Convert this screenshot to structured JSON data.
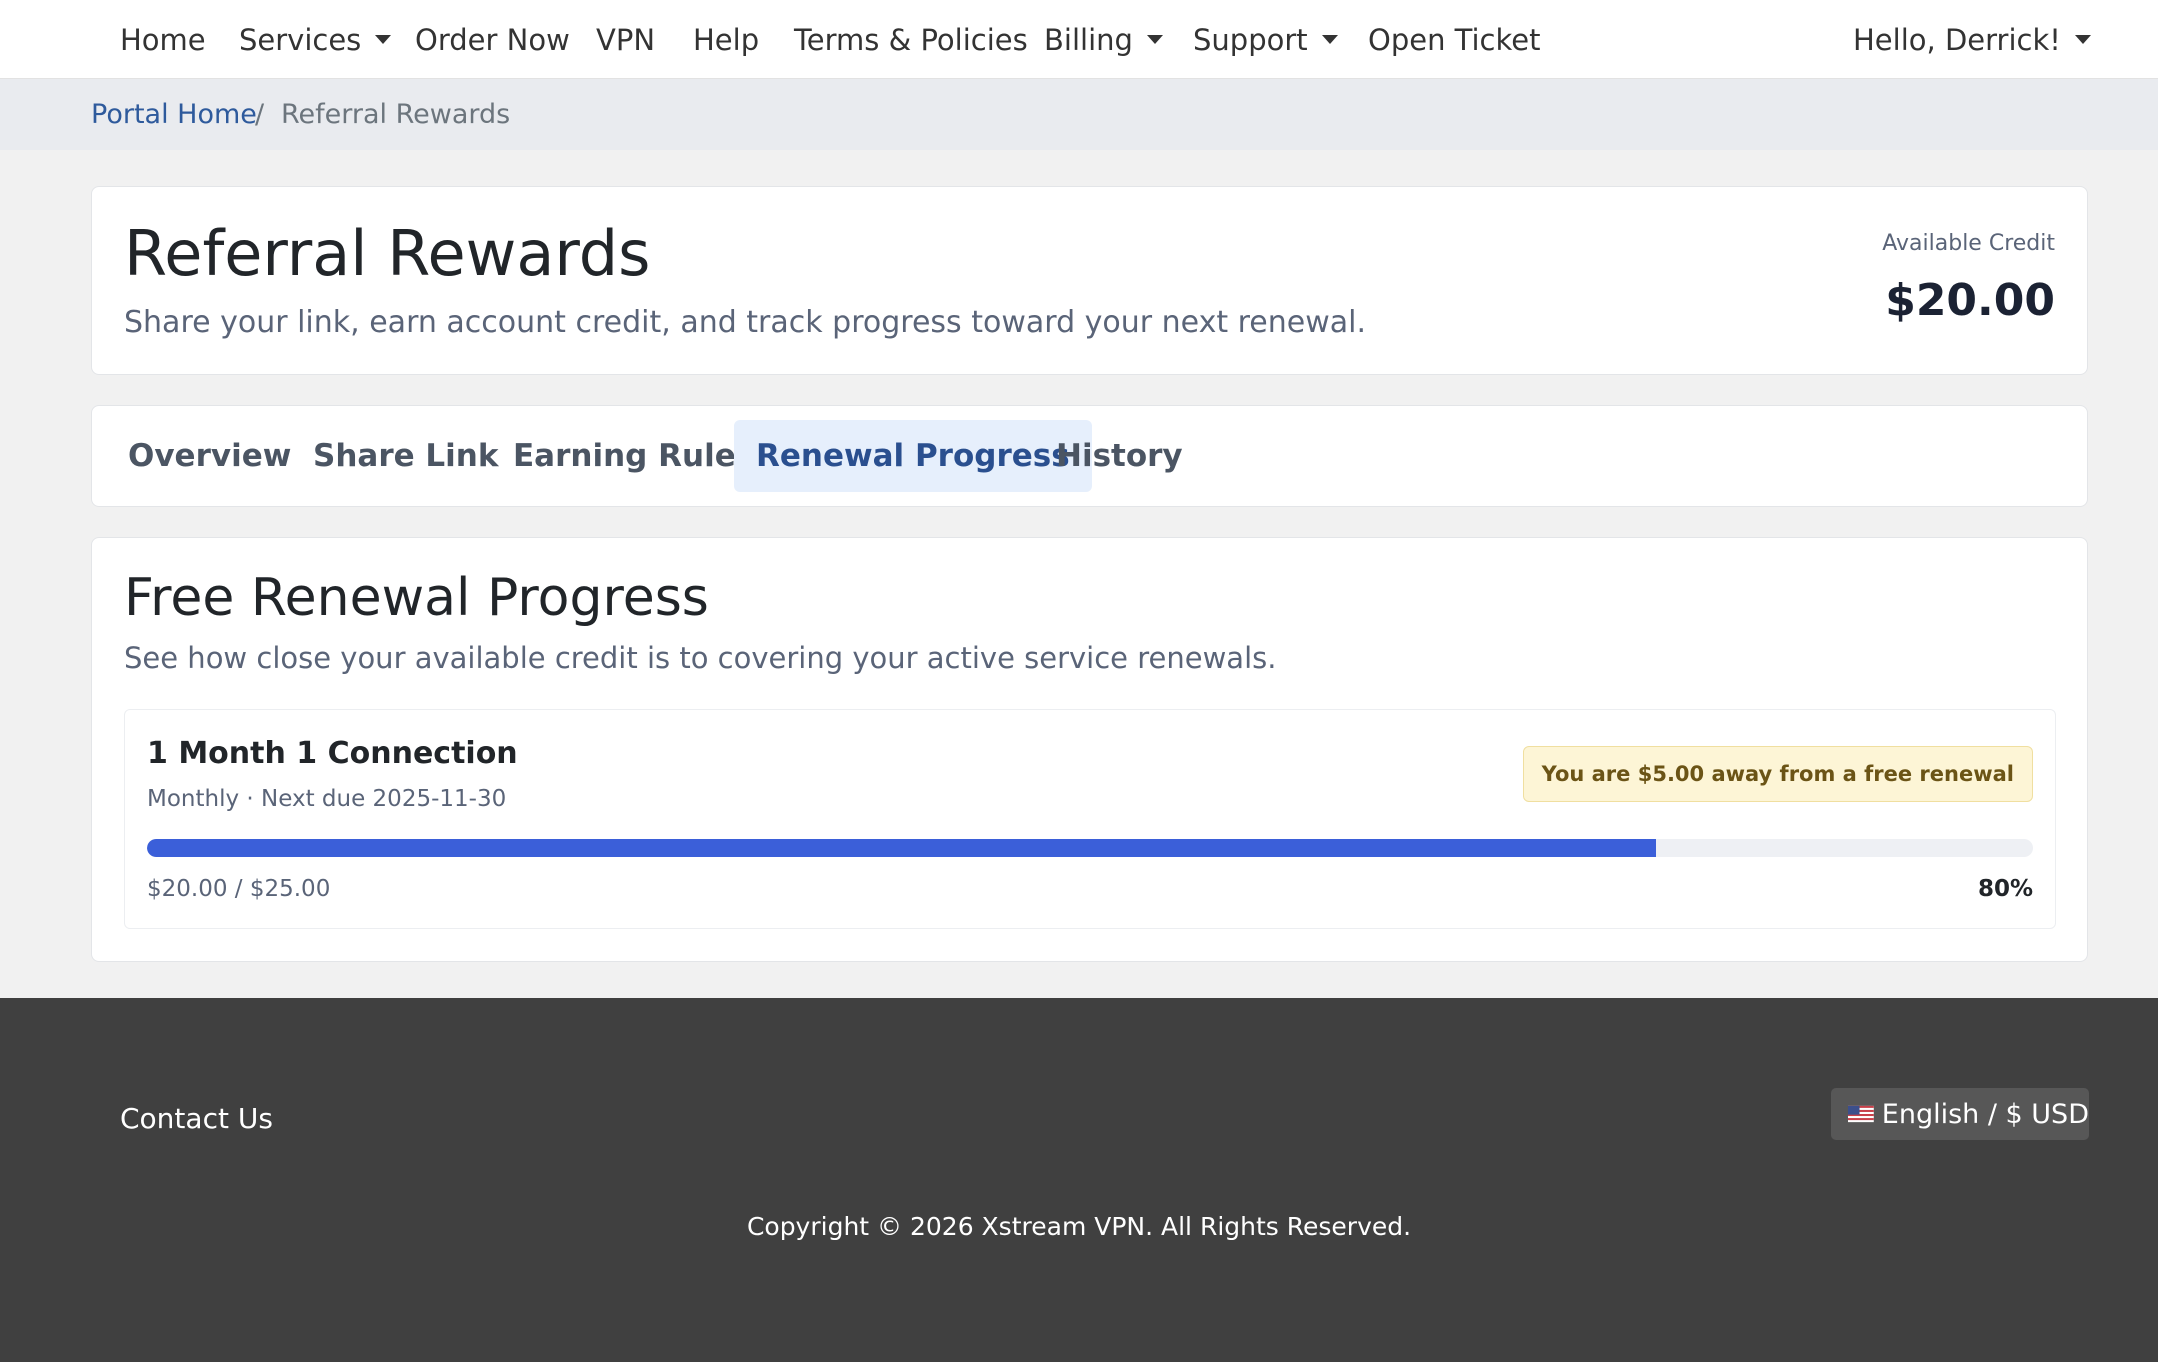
{
  "nav": {
    "home": "Home",
    "services": "Services",
    "order_now": "Order Now",
    "vpn": "VPN",
    "help": "Help",
    "terms": "Terms & Policies",
    "billing": "Billing",
    "support": "Support",
    "open_ticket": "Open Ticket",
    "user_greeting": "Hello, Derrick!"
  },
  "breadcrumb": {
    "home": "Portal Home",
    "separator": "/",
    "current": "Referral Rewards"
  },
  "header": {
    "title": "Referral Rewards",
    "subtitle": "Share your link, earn account credit, and track progress toward your next renewal.",
    "credit_label": "Available Credit",
    "credit_value": "$20.00"
  },
  "tabs": [
    {
      "label": "Overview",
      "active": false
    },
    {
      "label": "Share Link",
      "active": false
    },
    {
      "label": "Earning Rules",
      "active": false
    },
    {
      "label": "Renewal Progress",
      "active": true
    },
    {
      "label": "History",
      "active": false
    }
  ],
  "renewal": {
    "title": "Free Renewal Progress",
    "subtitle": "See how close your available credit is to covering your active service renewals.",
    "services": [
      {
        "name": "1 Month 1 Connection",
        "meta": "Monthly · Next due 2025-11-30",
        "badge": "You are $5.00 away from a free renewal",
        "amounts": "$20.00 / $25.00",
        "percent_label": "80%",
        "progress": 0.8
      }
    ]
  },
  "footer": {
    "contact": "Contact Us",
    "language": "English / $ USD",
    "copyright": "Copyright © 2026 Xstream VPN. All Rights Reserved."
  },
  "colors": {
    "progress_fill": "#3b5fd9",
    "active_tab_bg": "#e6effc",
    "badge_bg": "#fdf5d6",
    "footer_bg": "#404040",
    "link": "#2e5a9c"
  },
  "icons": {
    "dropdown": "caret-down-icon",
    "language_flag": "us-flag-icon"
  }
}
